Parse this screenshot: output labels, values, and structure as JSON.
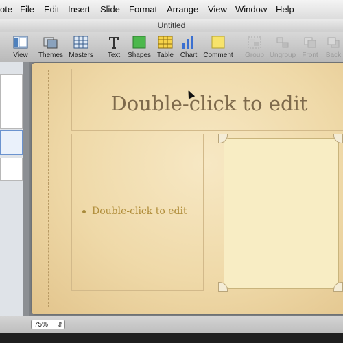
{
  "menubar": {
    "items": [
      {
        "label": "ote"
      },
      {
        "label": "File"
      },
      {
        "label": "Edit"
      },
      {
        "label": "Insert"
      },
      {
        "label": "Slide"
      },
      {
        "label": "Format"
      },
      {
        "label": "Arrange"
      },
      {
        "label": "View"
      },
      {
        "label": "Window"
      },
      {
        "label": "Help"
      }
    ]
  },
  "window": {
    "title": "Untitled"
  },
  "toolbar": {
    "view": "View",
    "themes": "Themes",
    "masters": "Masters",
    "text": "Text",
    "shapes": "Shapes",
    "table": "Table",
    "chart": "Chart",
    "comment": "Comment",
    "group": "Group",
    "ungroup": "Ungroup",
    "front": "Front",
    "back": "Back"
  },
  "slide": {
    "title_placeholder": "Double-click to edit",
    "bullet_placeholder": "Double-click to edit"
  },
  "status": {
    "zoom": "75%"
  },
  "colors": {
    "slide_bg": "#efd9a8",
    "title_text": "#7e6a4c",
    "bullet_text": "#b08d3a"
  }
}
